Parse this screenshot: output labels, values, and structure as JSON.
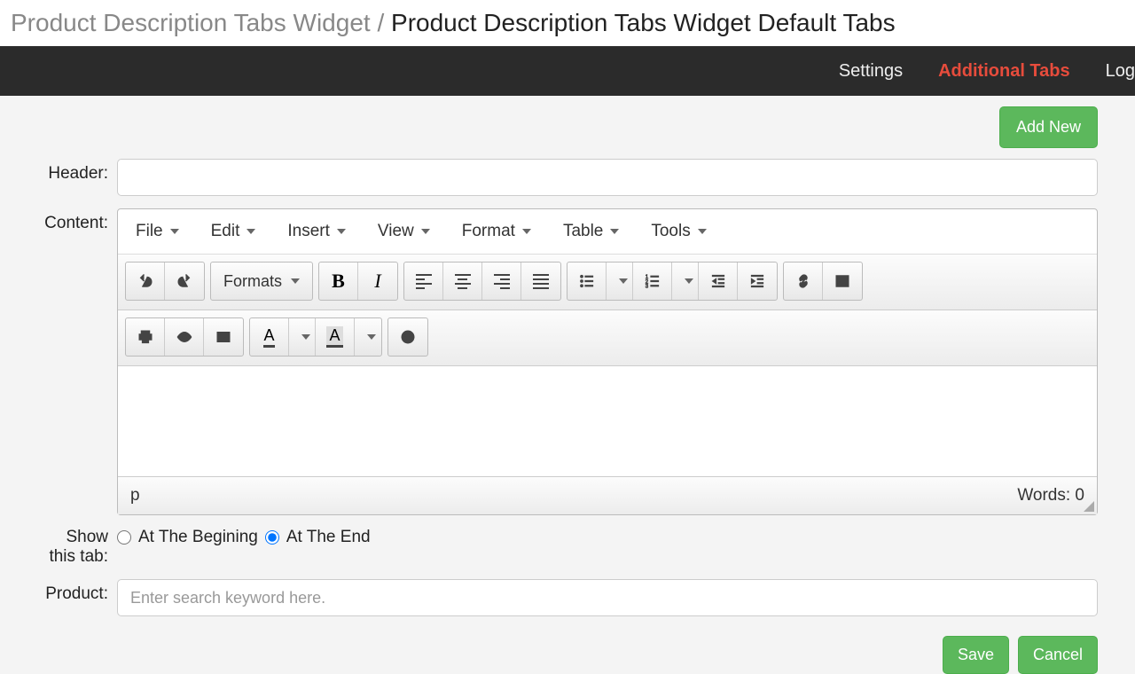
{
  "breadcrumb": {
    "parent": "Product Description Tabs Widget",
    "sep": " / ",
    "current": "Product Description Tabs Widget Default Tabs"
  },
  "topnav": {
    "settings": "Settings",
    "additional": "Additional Tabs",
    "log": "Log"
  },
  "buttons": {
    "add_new": "Add New",
    "save": "Save",
    "cancel": "Cancel"
  },
  "labels": {
    "header": "Header:",
    "content": "Content:",
    "showtab1": "Show",
    "showtab2": "this tab:",
    "product": "Product:"
  },
  "editor": {
    "menus": {
      "file": "File",
      "edit": "Edit",
      "insert": "Insert",
      "view": "View",
      "format": "Format",
      "table": "Table",
      "tools": "Tools"
    },
    "formats": "Formats",
    "status_path": "p",
    "words_label": "Words: ",
    "words_count": "0"
  },
  "radios": {
    "begin": "At The Begining",
    "end": "At The End"
  },
  "placeholders": {
    "product": "Enter search keyword here."
  },
  "values": {
    "header": ""
  }
}
